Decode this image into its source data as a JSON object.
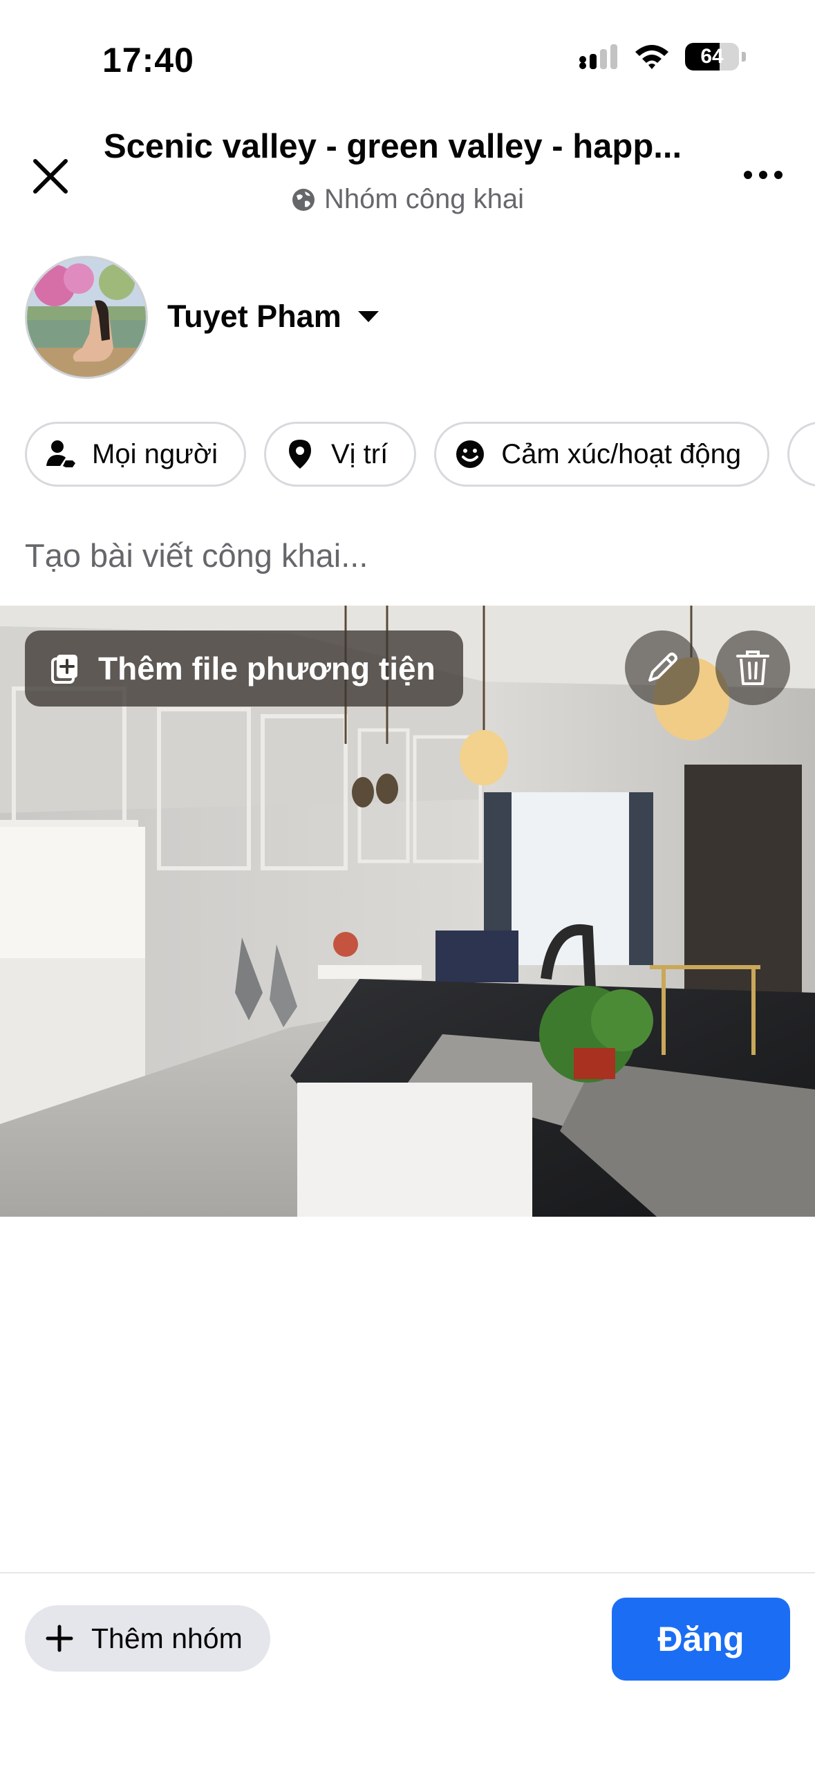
{
  "status_bar": {
    "time": "17:40",
    "battery_percent": 64,
    "battery_label": "64"
  },
  "header": {
    "title": "Scenic valley - green valley - happ...",
    "privacy_icon": "globe-icon",
    "privacy_label": "Nhóm công khai",
    "close_icon": "close-icon",
    "more_icon": "more-icon"
  },
  "author": {
    "name": "Tuyet Pham"
  },
  "chips": [
    {
      "icon": "person-icon",
      "label": "Mọi người"
    },
    {
      "icon": "location-pin-icon",
      "label": "Vị trí"
    },
    {
      "icon": "smiley-icon",
      "label": "Cảm xúc/hoạt động"
    }
  ],
  "composer": {
    "placeholder": "Tạo bài viết công khai..."
  },
  "media": {
    "add_label": "Thêm file phương tiện"
  },
  "bottom": {
    "add_group_label": "Thêm nhóm",
    "post_label": "Đăng"
  },
  "colors": {
    "accent": "#1b6ef3",
    "chip_border": "#d7d9dd",
    "secondary_text": "#65676b"
  }
}
